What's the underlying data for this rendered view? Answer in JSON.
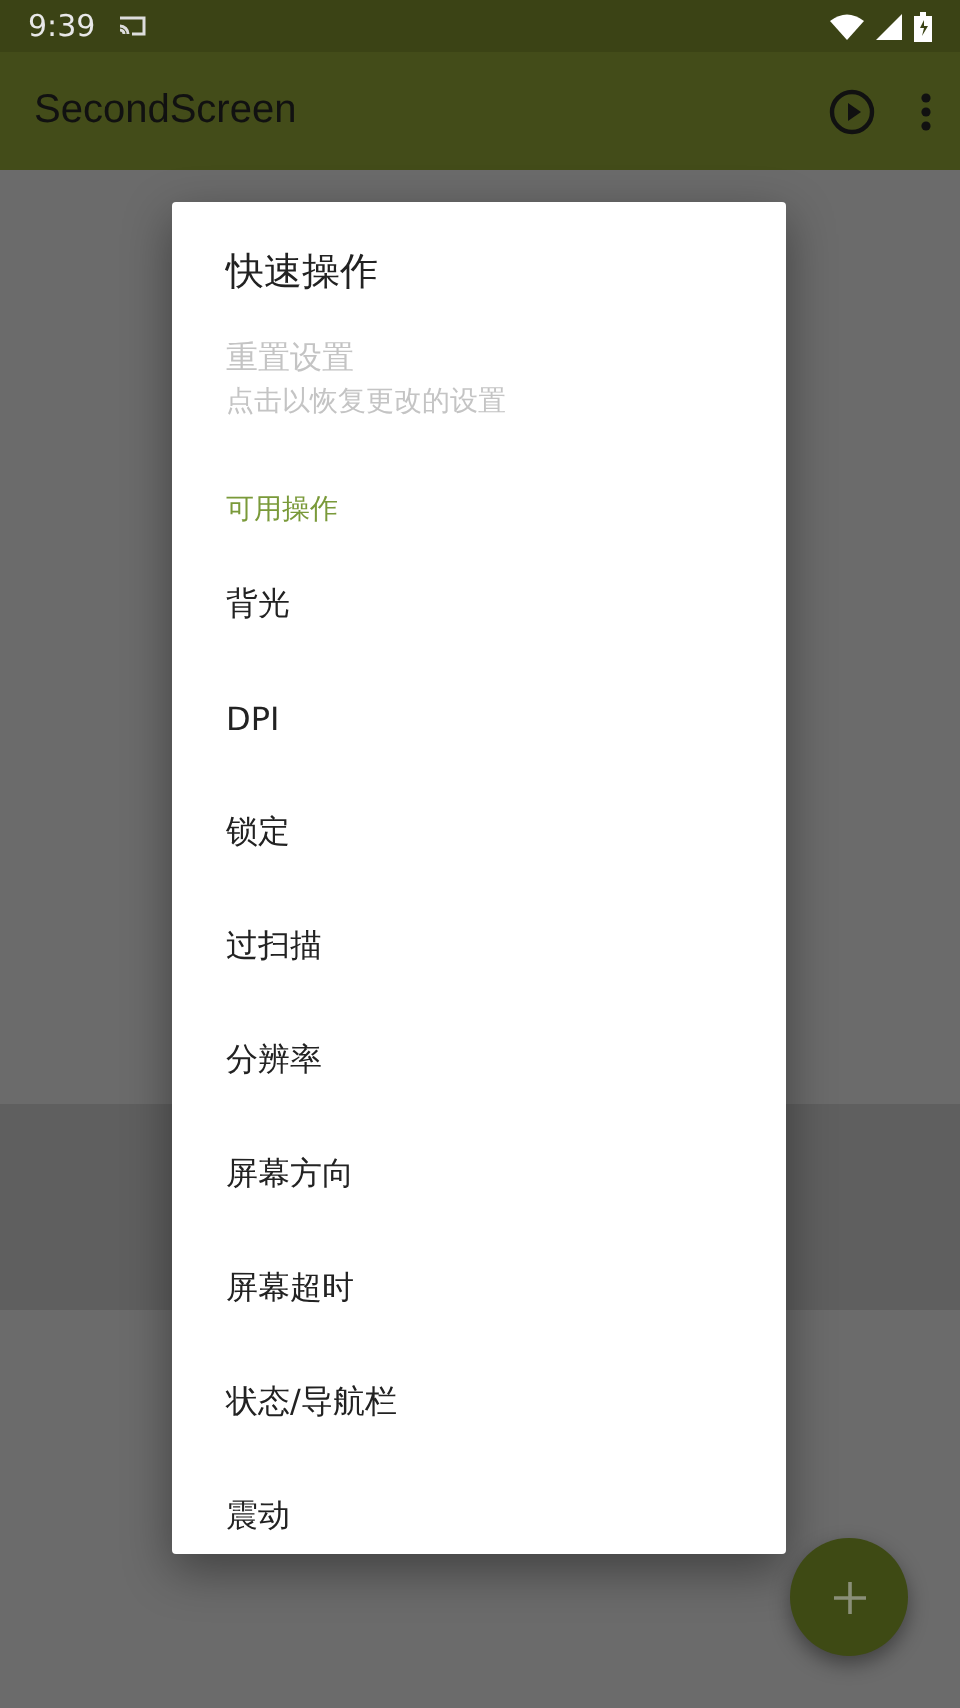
{
  "status_bar": {
    "time": "9:39"
  },
  "app_bar": {
    "title": "SecondScreen"
  },
  "dialog": {
    "title": "快速操作",
    "reset": {
      "title": "重置设置",
      "summary": "点击以恢复更改的设置",
      "disabled": true
    },
    "category": "可用操作",
    "items": [
      {
        "label": "背光"
      },
      {
        "label": "DPI"
      },
      {
        "label": "锁定"
      },
      {
        "label": "过扫描"
      },
      {
        "label": "分辨率"
      },
      {
        "label": "屏幕方向"
      },
      {
        "label": "屏幕超时"
      },
      {
        "label": "状态/导航栏"
      },
      {
        "label": "震动"
      }
    ]
  }
}
